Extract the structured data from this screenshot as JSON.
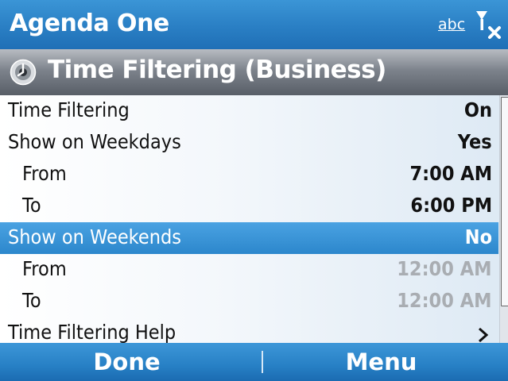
{
  "status_bar": {
    "app_title": "Agenda One",
    "input_mode": "abc",
    "signal_icon": "signal-off-icon"
  },
  "header": {
    "icon": "clock-gear-icon",
    "title": "Time Filtering (Business)"
  },
  "settings": {
    "rows": [
      {
        "label": "Time Filtering",
        "value": "On"
      },
      {
        "label": "Show on Weekdays",
        "value": "Yes"
      },
      {
        "label": "From",
        "value": "7:00 AM"
      },
      {
        "label": "To",
        "value": "6:00 PM"
      },
      {
        "label": "Show on Weekends",
        "value": "No"
      },
      {
        "label": "From",
        "value": "12:00 AM"
      },
      {
        "label": "To",
        "value": "12:00 AM"
      },
      {
        "label": "Time Filtering Help",
        "value": ""
      }
    ],
    "selected_index": 4,
    "disabled_value_color": "#a9adb2"
  },
  "softkeys": {
    "left": "Done",
    "right": "Menu"
  },
  "colors": {
    "titlebar_blue": "#2a7fc4",
    "selection_blue": "#2c87cc",
    "header_gray": "#6b717a"
  }
}
